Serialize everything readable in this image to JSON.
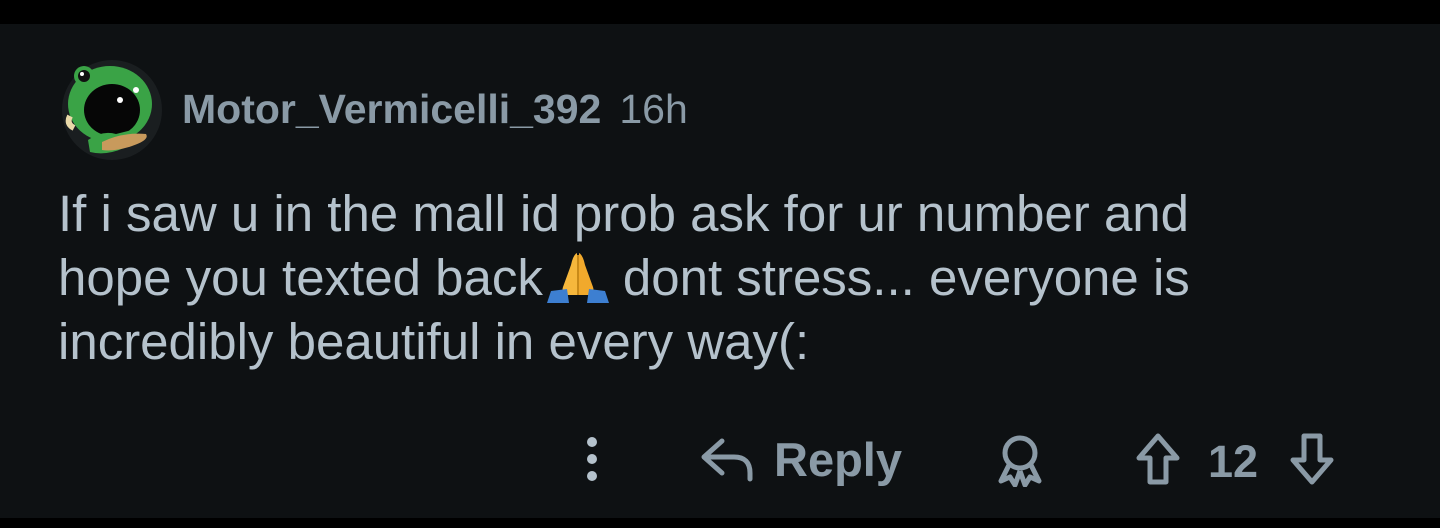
{
  "comment": {
    "username": "Motor_Vermicelli_392",
    "time": "16h",
    "line1": "If i saw u in the mall id prob ask for ur number and",
    "line2_before": "hope you texted back",
    "line2_after": "dont stress... everyone is",
    "line3": "incredibly beautiful in every way(:",
    "emoji": "folded-hands-emoji"
  },
  "actions": {
    "reply_label": "Reply",
    "score": "12",
    "more_icon": "more-vertical-icon",
    "reply_icon": "reply-arrow-icon",
    "award_icon": "award-icon",
    "upvote_icon": "upvote-arrow-icon",
    "downvote_icon": "downvote-arrow-icon"
  },
  "colors": {
    "background": "#0e1113",
    "text": "#b5c2cc",
    "meta": "#8a9aa6",
    "avatar_green": "#3aa346"
  }
}
